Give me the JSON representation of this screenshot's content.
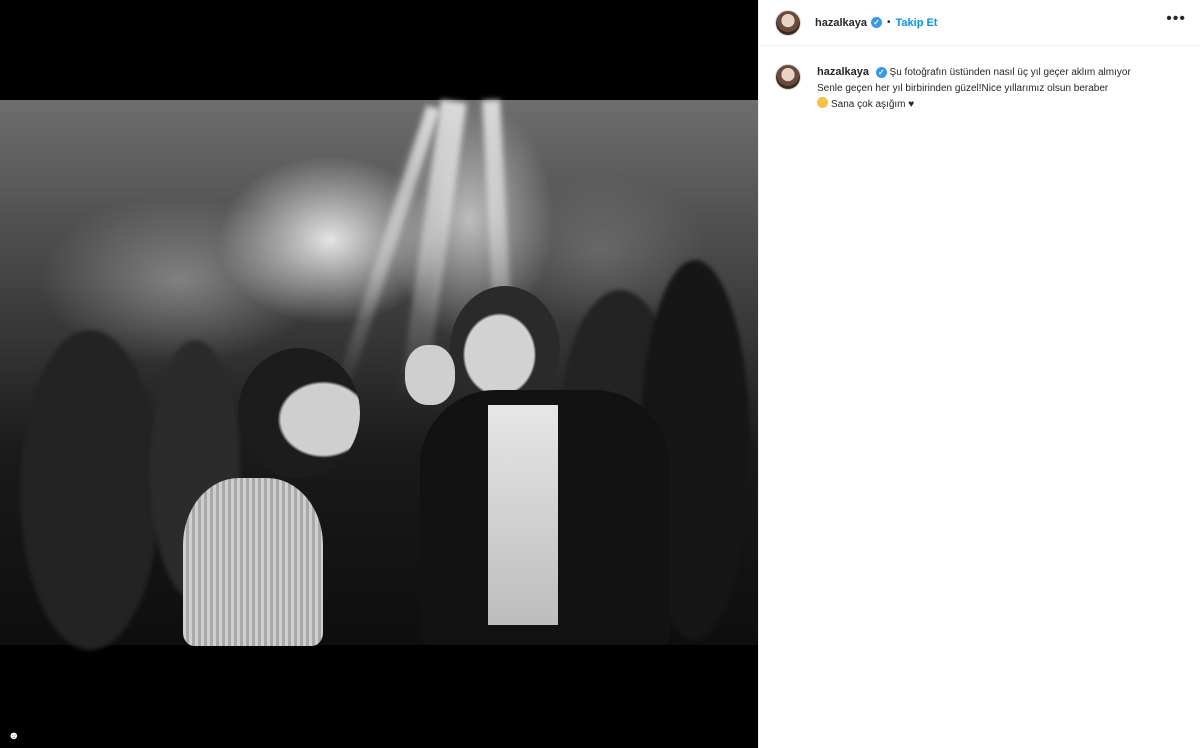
{
  "post": {
    "username": "hazalkaya",
    "verified_icon": "verified-badge-icon",
    "separator": "•",
    "follow_label": "Takip Et",
    "more_label": "•••",
    "caption": {
      "username": "hazalkaya",
      "line1": "Şu fotoğrafın üstünden nasıl üç yıl geçer aklım almıyor",
      "line2": "Senle geçen her yıl birbirinden güzel!Nice yıllarımız olsun beraber",
      "line3": "Sana çok aşığım ♥"
    }
  },
  "media": {
    "type": "photo",
    "style": "black-and-white",
    "corner_icon": "user-tag-icon"
  },
  "colors": {
    "accent": "#0095f6",
    "verified": "#3897f0",
    "text": "#262626"
  }
}
